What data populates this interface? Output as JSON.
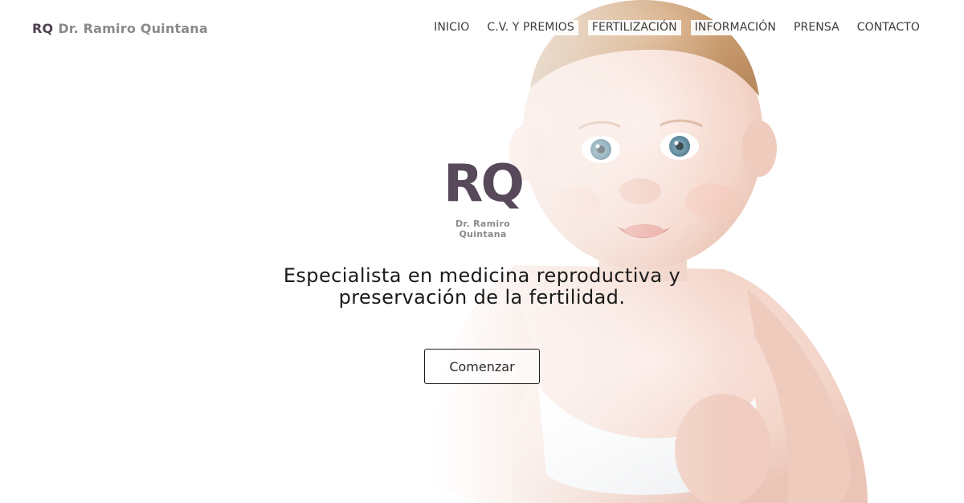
{
  "header": {
    "brand_monogram": "RQ",
    "brand_name": "Dr. Ramiro Quintana",
    "nav": [
      {
        "label": "INICIO"
      },
      {
        "label": "C.V. Y PREMIOS"
      },
      {
        "label": "FERTILIZACIÓN"
      },
      {
        "label": "INFORMACIÓN"
      },
      {
        "label": "PRENSA"
      },
      {
        "label": "CONTACTO"
      }
    ]
  },
  "hero": {
    "logo_monogram": "RQ",
    "logo_subtitle": "Dr. Ramiro Quintana",
    "headline_line1": "Especialista en medicina reproductiva y",
    "headline_line2": "preservación de la fertilidad.",
    "cta_label": "Comenzar",
    "background_image": "baby-photo"
  },
  "colors": {
    "brand_purple": "#57495a",
    "brand_gray": "#8a8a8a",
    "text_dark": "#1a1a1a",
    "background": "#ffffff"
  }
}
